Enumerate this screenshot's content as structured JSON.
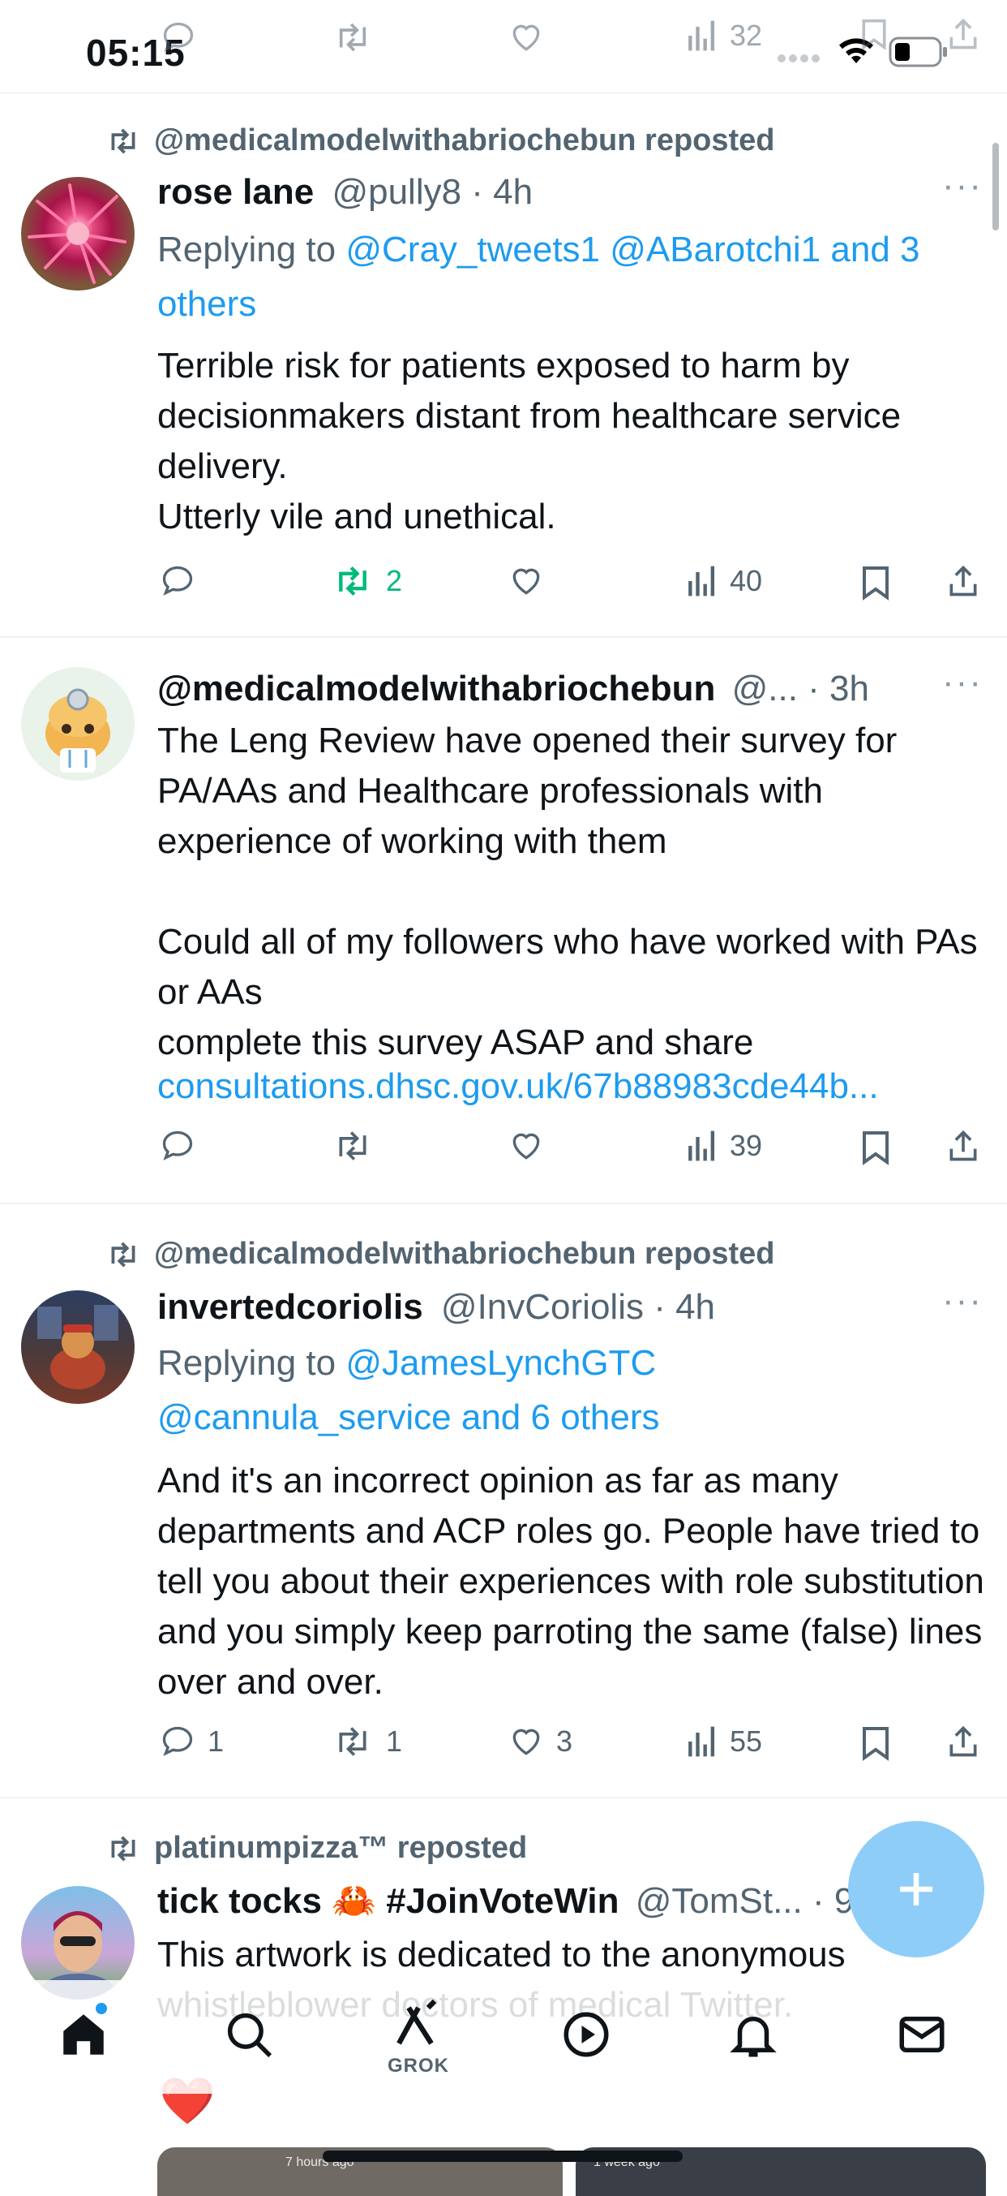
{
  "status_bar": {
    "time": "05:15",
    "top_views_count": "32"
  },
  "tweets": [
    {
      "reposted_by": "@medicalmodelwithabriochebun reposted",
      "name": "rose lane",
      "meta": "@pully8 · 4h",
      "reply_prefix": "Replying to ",
      "reply_links": "@Cray_tweets1 @ABarotchi1 and 3 others",
      "text": "Terrible risk for patients exposed to harm by decisionmakers distant from healthcare service delivery.\nUtterly vile and unethical.",
      "counts": {
        "replies": "",
        "reposts": "2",
        "likes": "",
        "views": "40"
      }
    },
    {
      "name": "@medicalmodelwithabriochebun",
      "meta": "@... · 3h",
      "text": "The Leng Review have opened their survey for PA/AAs and Healthcare professionals with experience of working with them\n\nCould all of my followers who have worked with PAs or AAs\ncomplete this survey ASAP and share",
      "link": "consultations.dhsc.gov.uk/67b88983cde44b...",
      "counts": {
        "replies": "",
        "reposts": "",
        "likes": "",
        "views": "39"
      }
    },
    {
      "reposted_by": "@medicalmodelwithabriochebun reposted",
      "name": "invertedcoriolis",
      "meta": "@InvCoriolis · 4h",
      "reply_prefix": "Replying to ",
      "reply_links": "@JamesLynchGTC @cannula_service and 6 others",
      "text": "And it's an incorrect opinion as far as many departments and ACP roles go. People have tried to tell you about their experiences with role substitution and you simply keep parroting the same (false) lines over and over.",
      "counts": {
        "replies": "1",
        "reposts": "1",
        "likes": "3",
        "views": "55"
      }
    },
    {
      "reposted_by": "platinumpizza™ reposted",
      "name": "tick tocks 🦀 #JoinVoteWin",
      "meta": "@TomSt... · 9h",
      "text": "This artwork is dedicated to the anonymous whistleblower doctors of medical Twitter.",
      "emoji": "❤️"
    }
  ],
  "tabbar": {
    "grok_label": "GROK"
  },
  "media_preview": {
    "left_time": "7 hours ago",
    "right_time": "1 week ago"
  },
  "colors": {
    "link": "#1d9bf0",
    "repost_green": "#00ba7c",
    "muted": "#536471"
  }
}
